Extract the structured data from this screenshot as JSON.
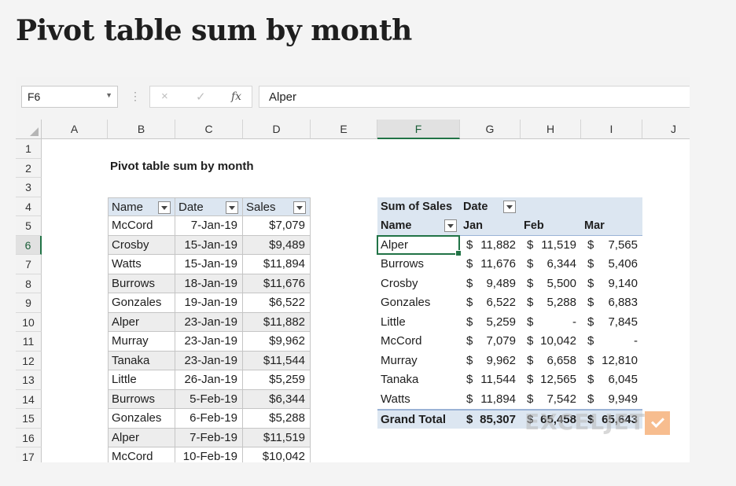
{
  "page_heading": "Pivot table sum by month",
  "formula_bar": {
    "name_box": "F6",
    "formula": "Alper",
    "cancel_icon": "×",
    "enter_icon": "✓",
    "fx_label": "fx"
  },
  "columns": [
    "A",
    "B",
    "C",
    "D",
    "E",
    "F",
    "G",
    "H",
    "I",
    "J"
  ],
  "rows": [
    "1",
    "2",
    "3",
    "4",
    "5",
    "6",
    "7",
    "8",
    "9",
    "10",
    "11",
    "12",
    "13",
    "14",
    "15",
    "16",
    "17"
  ],
  "active_cell": {
    "column": "F",
    "row": "6"
  },
  "sheet_title": "Pivot table sum by month",
  "source_table": {
    "headers": [
      "Name",
      "Date",
      "Sales"
    ],
    "rows": [
      [
        "McCord",
        "7-Jan-19",
        "$7,079"
      ],
      [
        "Crosby",
        "15-Jan-19",
        "$9,489"
      ],
      [
        "Watts",
        "15-Jan-19",
        "$11,894"
      ],
      [
        "Burrows",
        "18-Jan-19",
        "$11,676"
      ],
      [
        "Gonzales",
        "19-Jan-19",
        "$6,522"
      ],
      [
        "Alper",
        "23-Jan-19",
        "$11,882"
      ],
      [
        "Murray",
        "23-Jan-19",
        "$9,962"
      ],
      [
        "Tanaka",
        "23-Jan-19",
        "$11,544"
      ],
      [
        "Little",
        "26-Jan-19",
        "$5,259"
      ],
      [
        "Burrows",
        "5-Feb-19",
        "$6,344"
      ],
      [
        "Gonzales",
        "6-Feb-19",
        "$5,288"
      ],
      [
        "Alper",
        "7-Feb-19",
        "$11,519"
      ],
      [
        "McCord",
        "10-Feb-19",
        "$10,042"
      ]
    ]
  },
  "pivot": {
    "values_label": "Sum of Sales",
    "column_field": "Date",
    "row_field": "Name",
    "months": [
      "Jan",
      "Feb",
      "Mar"
    ],
    "rows": [
      {
        "name": "Alper",
        "values": [
          [
            "$",
            "11,882"
          ],
          [
            "$",
            "11,519"
          ],
          [
            "$",
            "7,565"
          ]
        ]
      },
      {
        "name": "Burrows",
        "values": [
          [
            "$",
            "11,676"
          ],
          [
            "$",
            "6,344"
          ],
          [
            "$",
            "5,406"
          ]
        ]
      },
      {
        "name": "Crosby",
        "values": [
          [
            "$",
            "9,489"
          ],
          [
            "$",
            "5,500"
          ],
          [
            "$",
            "9,140"
          ]
        ]
      },
      {
        "name": "Gonzales",
        "values": [
          [
            "$",
            "6,522"
          ],
          [
            "$",
            "5,288"
          ],
          [
            "$",
            "6,883"
          ]
        ]
      },
      {
        "name": "Little",
        "values": [
          [
            "$",
            "5,259"
          ],
          [
            "$",
            "-"
          ],
          [
            "$",
            "7,845"
          ]
        ]
      },
      {
        "name": "McCord",
        "values": [
          [
            "$",
            "7,079"
          ],
          [
            "$",
            "10,042"
          ],
          [
            "$",
            "-"
          ]
        ]
      },
      {
        "name": "Murray",
        "values": [
          [
            "$",
            "9,962"
          ],
          [
            "$",
            "6,658"
          ],
          [
            "$",
            "12,810"
          ]
        ]
      },
      {
        "name": "Tanaka",
        "values": [
          [
            "$",
            "11,544"
          ],
          [
            "$",
            "12,565"
          ],
          [
            "$",
            "6,045"
          ]
        ]
      },
      {
        "name": "Watts",
        "values": [
          [
            "$",
            "11,894"
          ],
          [
            "$",
            "7,542"
          ],
          [
            "$",
            "9,949"
          ]
        ]
      }
    ],
    "grand_total_label": "Grand Total",
    "grand_totals": [
      [
        "$",
        "85,307"
      ],
      [
        "$",
        "65,458"
      ],
      [
        "$",
        "65,643"
      ]
    ]
  },
  "watermark": "EXCELJET"
}
